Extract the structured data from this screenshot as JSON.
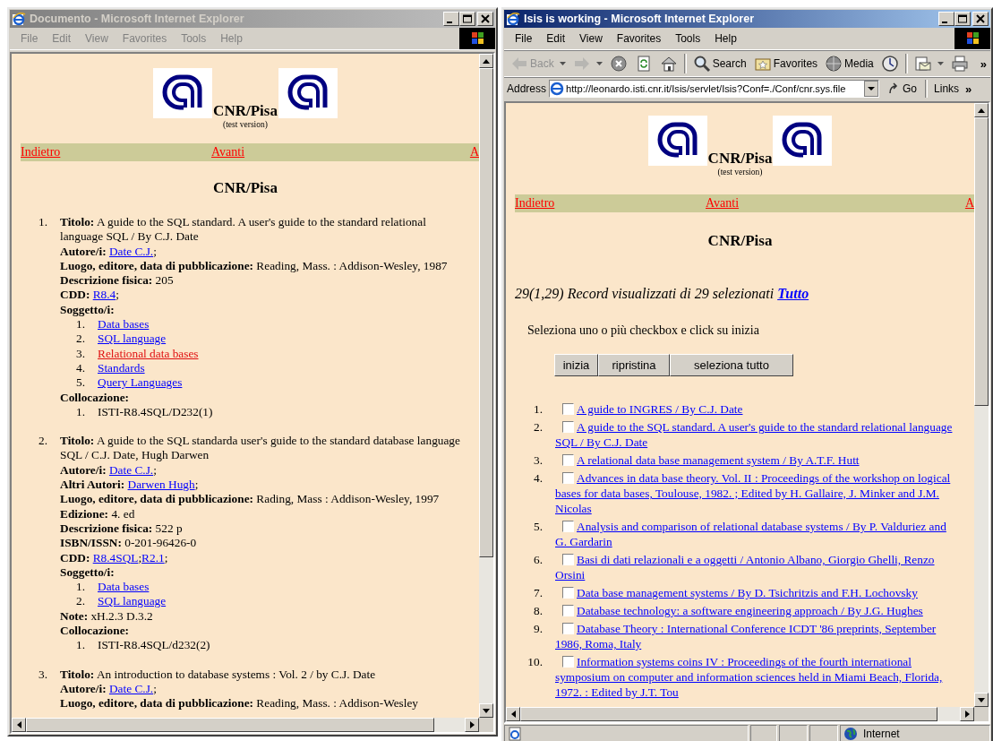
{
  "windows": [
    {
      "title": "Documento - Microsoft Internet Explorer",
      "active": false,
      "menu": [
        "File",
        "Edit",
        "View",
        "Favorites",
        "Tools",
        "Help"
      ],
      "page": {
        "header": {
          "title": "CNR/Pisa",
          "subtitle": "(test version)"
        },
        "nav": [
          "Indietro",
          "Avanti",
          "A"
        ],
        "heading": "CNR/Pisa",
        "records": [
          {
            "number": "1.",
            "fields": [
              {
                "label": "Titolo:",
                "text": "A guide to the SQL standard. A user's guide to the standard relational language SQL / By C.J. Date"
              },
              {
                "label": "Autore/i:",
                "links": [
                  {
                    "text": "Date C.J.",
                    "suffix": ";"
                  }
                ]
              },
              {
                "label": "Luogo, editore, data di pubblicazione:",
                "text": "Reading, Mass. : Addison-Wesley, 1987"
              },
              {
                "label": "Descrizione fisica:",
                "text": "205"
              },
              {
                "label": "CDD:",
                "links": [
                  {
                    "text": "R8.4",
                    "suffix": ";"
                  }
                ]
              },
              {
                "label": "Soggetto/i:",
                "list": [
                  {
                    "number": "1.",
                    "kind": "link",
                    "text": "Data bases",
                    "visited": false
                  },
                  {
                    "number": "2.",
                    "kind": "link",
                    "text": "SQL language",
                    "visited": false
                  },
                  {
                    "number": "3.",
                    "kind": "link",
                    "text": "Relational data bases",
                    "visited": true
                  },
                  {
                    "number": "4.",
                    "kind": "link",
                    "text": "Standards",
                    "visited": false
                  },
                  {
                    "number": "5.",
                    "kind": "link",
                    "text": "Query Languages",
                    "visited": false
                  }
                ]
              },
              {
                "label": "Collocazione:",
                "list": [
                  {
                    "number": "1.",
                    "kind": "text",
                    "text": "ISTI-R8.4SQL/D232(1)"
                  }
                ]
              }
            ]
          },
          {
            "number": "2.",
            "fields": [
              {
                "label": "Titolo:",
                "text": "A guide to the SQL standarda user's guide to the standard database language SQL / C.J. Date, Hugh Darwen"
              },
              {
                "label": "Autore/i:",
                "links": [
                  {
                    "text": "Date C.J.",
                    "suffix": ";"
                  }
                ]
              },
              {
                "label": "Altri Autori:",
                "links": [
                  {
                    "text": "Darwen Hugh",
                    "suffix": ";"
                  }
                ]
              },
              {
                "label": "Luogo, editore, data di pubblicazione:",
                "text": "Rading, Mass : Addison-Wesley, 1997"
              },
              {
                "label": "Edizione:",
                "text": "4. ed"
              },
              {
                "label": "Descrizione fisica:",
                "text": "522 p"
              },
              {
                "label": "ISBN/ISSN:",
                "text": "0-201-96426-0"
              },
              {
                "label": "CDD:",
                "links": [
                  {
                    "text": "R8.4SQL",
                    "suffix": ";"
                  },
                  {
                    "text": "R2.1",
                    "suffix": ";"
                  }
                ]
              },
              {
                "label": "Soggetto/i:",
                "list": [
                  {
                    "number": "1.",
                    "kind": "link",
                    "text": "Data bases",
                    "visited": false
                  },
                  {
                    "number": "2.",
                    "kind": "link",
                    "text": "SQL language",
                    "visited": false
                  }
                ]
              },
              {
                "label": "Note:",
                "text": "xH.2.3 D.3.2"
              },
              {
                "label": "Collocazione:",
                "list": [
                  {
                    "number": "1.",
                    "kind": "text",
                    "text": "ISTI-R8.4SQL/d232(2)"
                  }
                ]
              }
            ]
          },
          {
            "number": "3.",
            "fields": [
              {
                "label": "Titolo:",
                "text": "An introduction to database systems : Vol. 2 / by C.J. Date"
              },
              {
                "label": "Autore/i:",
                "links": [
                  {
                    "text": "Date C.J.",
                    "suffix": ";"
                  }
                ]
              },
              {
                "label": "Luogo, editore, data di pubblicazione:",
                "text": "Reading, Mass. : Addison-Wesley"
              }
            ]
          }
        ]
      }
    },
    {
      "title": "Isis is working - Microsoft Internet Explorer",
      "active": true,
      "menu": [
        "File",
        "Edit",
        "View",
        "Favorites",
        "Tools",
        "Help"
      ],
      "toolbar": {
        "items": [
          {
            "kind": "back",
            "label": "Back",
            "disabled": true
          },
          {
            "kind": "forward",
            "disabled": true
          },
          {
            "kind": "stop",
            "disabled": false
          },
          {
            "kind": "refresh",
            "disabled": false
          },
          {
            "kind": "home",
            "disabled": false
          },
          {
            "kind": "search",
            "label": "Search",
            "disabled": false
          },
          {
            "kind": "favorites",
            "label": "Favorites",
            "disabled": false
          },
          {
            "kind": "media",
            "label": "Media",
            "disabled": false
          },
          {
            "kind": "history",
            "disabled": false
          },
          {
            "kind": "mail",
            "disabled": false
          },
          {
            "kind": "print",
            "disabled": false
          }
        ],
        "more": "»"
      },
      "address": {
        "label": "Address",
        "url": "http://leonardo.isti.cnr.it/Isis/servlet/Isis?Conf=./Conf/cnr.sys.file",
        "go": "Go",
        "links": "Links",
        "more": "»"
      },
      "page": {
        "header": {
          "title": "CNR/Pisa",
          "subtitle": "(test version)"
        },
        "nav": [
          "Indietro",
          "Avanti",
          "A"
        ],
        "heading": "CNR/Pisa",
        "summary": {
          "text": "29(1,29) Record visualizzati di 29 selezionati",
          "link": "Tutto"
        },
        "instruction": "Seleziona uno o più checkbox e click su inizia",
        "buttons": [
          "inizia",
          "ripristina",
          "seleziona tutto"
        ],
        "results": [
          {
            "number": "1.",
            "checked": false,
            "title": "A guide to INGRES / By C.J. Date"
          },
          {
            "number": "2.",
            "checked": false,
            "title": "A guide to the SQL standard. A user's guide to the standard relational language SQL / By C.J. Date"
          },
          {
            "number": "3.",
            "checked": false,
            "title": "A relational data base management system / By A.T.F. Hutt"
          },
          {
            "number": "4.",
            "checked": false,
            "title": "Advances in data base theory. Vol. II : Proceedings of the workshop on logical bases for data bases, Toulouse, 1982. ; Edited by H. Gallaire, J. Minker and J.M. Nicolas"
          },
          {
            "number": "5.",
            "checked": false,
            "title": "Analysis and comparison of relational database systems / By P. Valduriez and G. Gardarin"
          },
          {
            "number": "6.",
            "checked": false,
            "title": "Basi di dati relazionali e a oggetti / Antonio Albano, Giorgio Ghelli, Renzo Orsini"
          },
          {
            "number": "7.",
            "checked": false,
            "title": "Data base management systems / By D. Tsichritzis and F.H. Lochovsky"
          },
          {
            "number": "8.",
            "checked": false,
            "title": "Database technology: a software engineering approach / By J.G. Hughes"
          },
          {
            "number": "9.",
            "checked": false,
            "title": "Database Theory : International Conference ICDT '86 preprints, September 1986, Roma, Italy"
          },
          {
            "number": "10.",
            "checked": false,
            "title": "Information systems coins IV : Proceedings of the fourth international symposium on computer and information sciences held in Miami Beach, Florida, 1972. : Edited by J.T. Tou"
          }
        ]
      },
      "status": {
        "zone": "Internet"
      }
    }
  ]
}
